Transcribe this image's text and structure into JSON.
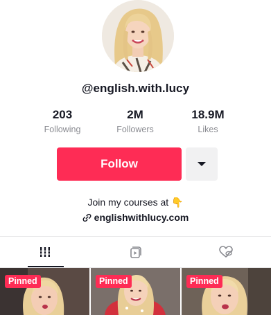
{
  "profile": {
    "avatar_icon": "profile-photo",
    "username": "@english.with.lucy"
  },
  "stats": [
    {
      "value": "203",
      "label": "Following"
    },
    {
      "value": "2M",
      "label": "Followers"
    },
    {
      "value": "18.9M",
      "label": "Likes"
    }
  ],
  "actions": {
    "follow_label": "Follow",
    "more_icon": "caret-down-icon"
  },
  "bio": {
    "line1": "Join my courses at",
    "line1_emoji": "👇",
    "link_icon": "link-icon",
    "link": "englishwithlucy.com"
  },
  "tabs": [
    {
      "name": "videos",
      "icon": "grid-icon",
      "active": true
    },
    {
      "name": "reposts",
      "icon": "repost-icon",
      "active": false
    },
    {
      "name": "liked",
      "icon": "liked-icon",
      "active": false
    }
  ],
  "videos": [
    {
      "badge": "Pinned"
    },
    {
      "badge": "Pinned"
    },
    {
      "badge": "Pinned"
    }
  ],
  "colors": {
    "accent": "#fe2c55",
    "secondary_button": "#f1f1f2",
    "muted_text": "#8a8b91"
  }
}
